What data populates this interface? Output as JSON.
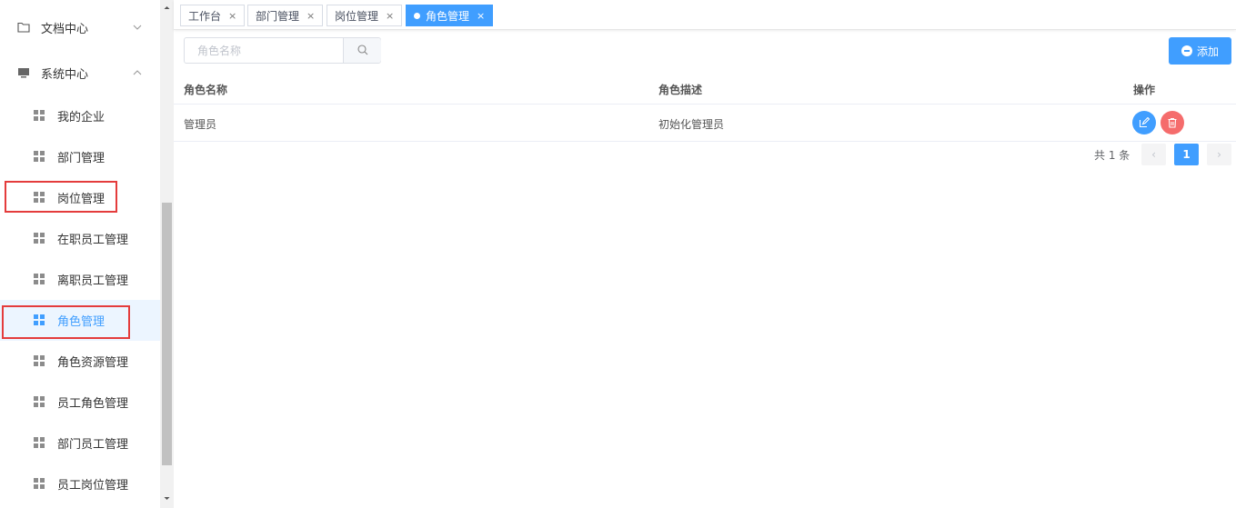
{
  "sidebar": {
    "groups": [
      {
        "label": "文档中心",
        "expanded": false
      },
      {
        "label": "系统中心",
        "expanded": true
      }
    ],
    "items": [
      {
        "label": "我的企业"
      },
      {
        "label": "部门管理"
      },
      {
        "label": "岗位管理"
      },
      {
        "label": "在职员工管理"
      },
      {
        "label": "离职员工管理"
      },
      {
        "label": "角色管理"
      },
      {
        "label": "角色资源管理"
      },
      {
        "label": "员工角色管理"
      },
      {
        "label": "部门员工管理"
      },
      {
        "label": "员工岗位管理"
      }
    ],
    "active_index": 5
  },
  "tabs": [
    {
      "label": "工作台",
      "close": "×"
    },
    {
      "label": "部门管理",
      "close": "×"
    },
    {
      "label": "岗位管理",
      "close": "×"
    },
    {
      "label": "角色管理",
      "close": "×",
      "active": true
    }
  ],
  "toolbar": {
    "search_placeholder": "角色名称",
    "add_label": "添加"
  },
  "table": {
    "columns": [
      "角色名称",
      "角色描述",
      "操作"
    ],
    "rows": [
      {
        "name": "管理员",
        "description": "初始化管理员"
      }
    ]
  },
  "pagination": {
    "total_text": "共 1 条",
    "current_page": "1",
    "prev": "‹",
    "next": "›"
  },
  "colors": {
    "primary": "#409eff",
    "danger": "#f56c6c",
    "highlight_box": "#e43c3c"
  }
}
